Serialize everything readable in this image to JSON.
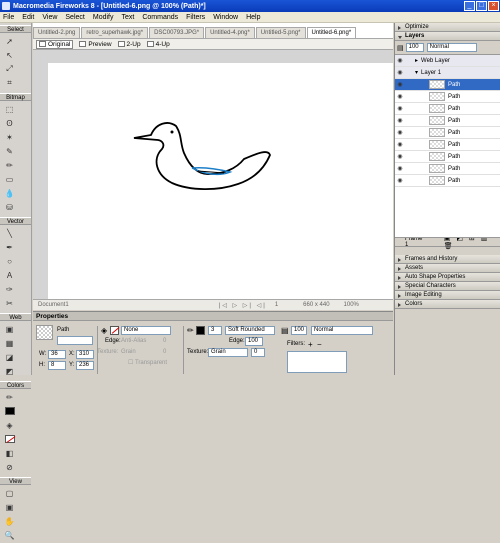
{
  "app": {
    "title": "Macromedia Fireworks 8 - [Untitled-6.png @ 100% (Path)*]"
  },
  "menu": [
    "File",
    "Edit",
    "View",
    "Select",
    "Modify",
    "Text",
    "Commands",
    "Filters",
    "Window",
    "Help"
  ],
  "toolbox": {
    "sections": [
      "Select",
      "Bitmap",
      "Vector",
      "Web",
      "Colors",
      "View"
    ]
  },
  "tabs": [
    "Untitled-2.png",
    "retro_superhawk.jpg*",
    "DSC00793.JPG*",
    "Untitled-4.png*",
    "Untitled-5.png*",
    "Untitled-6.png*"
  ],
  "view": {
    "original": "Original",
    "preview": "Preview",
    "two_up": "2-Up",
    "four_up": "4-Up"
  },
  "status": {
    "doc": "Document1",
    "page": "1",
    "size": "660 x 440",
    "zoom": "100%"
  },
  "props": {
    "title": "Properties",
    "object": "Path",
    "fill": "None",
    "edge_label": "Edge:",
    "edge_value": "Anti-Alias",
    "edge_num": "0",
    "texture_label": "Texture:",
    "texture_value": "Grain",
    "texture_num": "0",
    "transparent": "Transparent",
    "stroke_size": "3",
    "stroke_type": "Soft Rounded",
    "stroke_edge_label": "Edge:",
    "stroke_edge_num": "100",
    "stroke_texture_label": "Texture:",
    "stroke_texture_value": "Grain",
    "stroke_texture_num": "0",
    "opacity": "100",
    "blend": "Normal",
    "filters_label": "Filters:",
    "w_label": "W:",
    "w": "36",
    "x_label": "X:",
    "x": "310",
    "h_label": "H:",
    "h": "8",
    "y_label": "Y:",
    "y": "236"
  },
  "panels": {
    "optimize": "Optimize",
    "layers": "Layers",
    "opacity": "100",
    "blend": "Normal",
    "web_layer": "Web Layer",
    "layer1": "Layer 1",
    "paths": [
      "Path",
      "Path",
      "Path",
      "Path",
      "Path",
      "Path",
      "Path",
      "Path",
      "Path"
    ],
    "frame": "Frame 1",
    "others": [
      "Frames and History",
      "Assets",
      "Auto Shape Properties",
      "Special Characters",
      "Image Editing",
      "Colors"
    ]
  },
  "colors": {
    "selection": "#316ac5",
    "titlebar": "#0a3bb8"
  }
}
